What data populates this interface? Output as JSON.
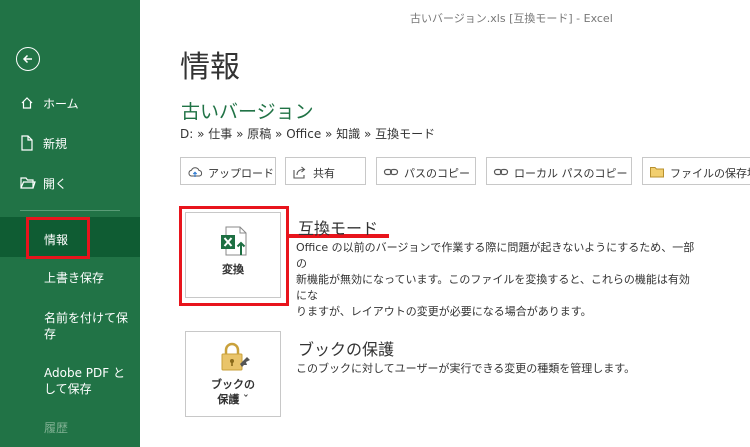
{
  "window": {
    "title": "古いバージョン.xls  [互換モード]  -  Excel"
  },
  "sidebar": {
    "back_icon": "back-arrow-icon",
    "items": [
      {
        "label": "ホーム",
        "icon": "home-icon"
      },
      {
        "label": "新規",
        "icon": "new-document-icon"
      },
      {
        "label": "開く",
        "icon": "open-folder-icon"
      }
    ],
    "active": "情報",
    "sub_items": [
      {
        "label": "上書き保存"
      },
      {
        "label": "名前を付けて保存"
      },
      {
        "label": "Adobe PDF として保存"
      },
      {
        "label": "履歴"
      }
    ]
  },
  "main": {
    "page_title": "情報",
    "doc_title": "古いバージョン",
    "breadcrumb": "D: » 仕事 » 原稿 » Office » 知識 » 互換モード",
    "toolbar": [
      {
        "label": "アップロード",
        "icon": "upload-icon"
      },
      {
        "label": "共有",
        "icon": "share-icon"
      },
      {
        "label": "パスのコピー",
        "icon": "link-icon"
      },
      {
        "label": "ローカル パスのコピー",
        "icon": "link-icon"
      },
      {
        "label": "ファイルの保存場",
        "icon": "folder-icon"
      }
    ],
    "compat": {
      "button_label": "変換",
      "heading": "互換モード",
      "lines": [
        "Office の以前のバージョンで作業する際に問題が起きないようにするため、一部の",
        "新機能が無効になっています。このファイルを変換すると、これらの機能は有効にな",
        "りますが、レイアウトの変更が必要になる場合があります。"
      ]
    },
    "protect": {
      "button_label_1": "ブックの",
      "button_label_2": "保護 ˇ",
      "heading": "ブックの保護",
      "text": "このブックに対してユーザーが実行できる変更の種類を管理します。"
    }
  },
  "colors": {
    "accent": "#217346",
    "active": "#0f5c33",
    "highlight": "#e8141c"
  }
}
